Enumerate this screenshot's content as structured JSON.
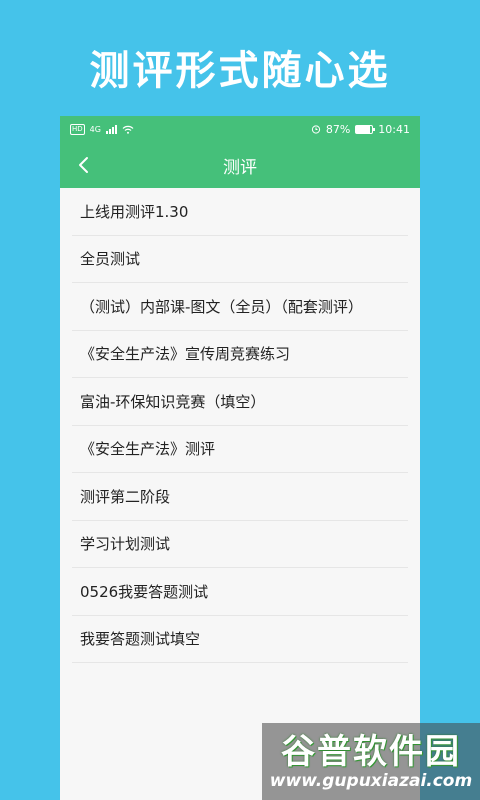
{
  "headline": "测评形式随心选",
  "status_bar": {
    "hd": "HD",
    "network": "4G",
    "battery": "87%",
    "battery_level": 0.87,
    "time": "10:41"
  },
  "nav": {
    "title": "测评",
    "back_icon": "chevron-left-icon"
  },
  "list": {
    "items": [
      "上线用测评1.30",
      "全员测试",
      "（测试）内部课-图文（全员）（配套测评）",
      "《安全生产法》宣传周竞赛练习",
      "富油-环保知识竞赛（填空）",
      "《安全生产法》测评",
      "测评第二阶段",
      "学习计划测试",
      "0526我要答题测试",
      "我要答题测试填空"
    ]
  },
  "watermark": {
    "main": "谷普软件园",
    "sub": "www.gupuxiazai.com"
  },
  "colors": {
    "background": "#45c3ea",
    "header": "#45c07a",
    "list_bg": "#f7f7f7"
  }
}
